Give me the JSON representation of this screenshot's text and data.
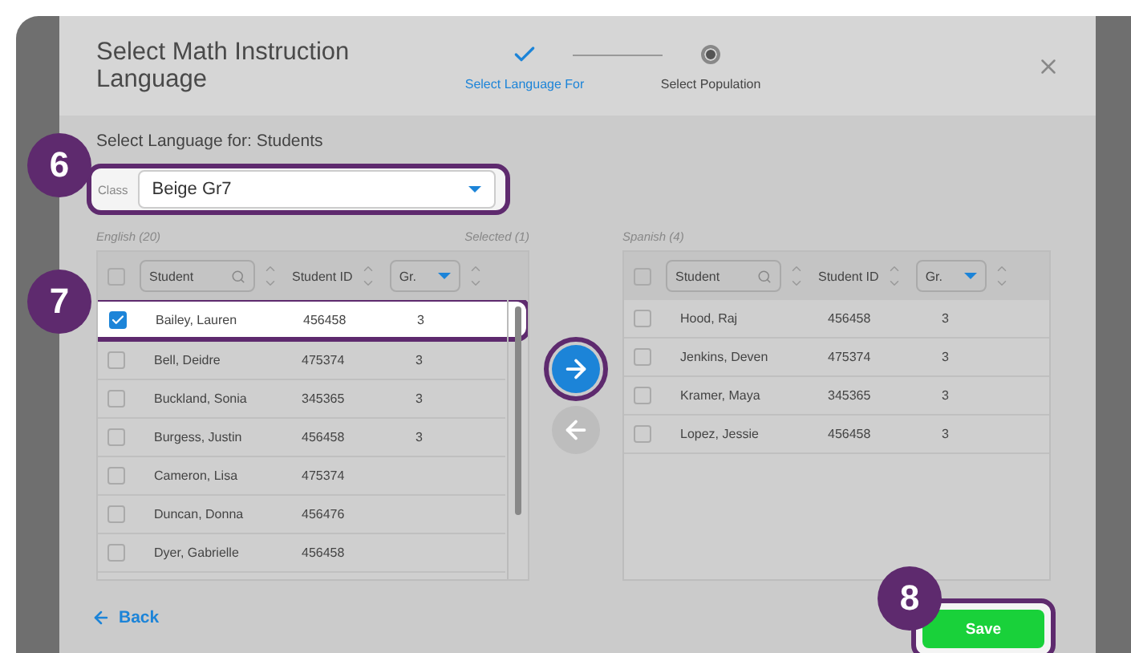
{
  "modal": {
    "title": "Select Math Instruction Language",
    "steps": [
      {
        "label": "Select Language For",
        "done": true
      },
      {
        "label": "Select Population",
        "done": false
      }
    ]
  },
  "prompt": "Select Language for: Students",
  "class_field": {
    "label": "Class",
    "value": "Beige Gr7"
  },
  "left_list": {
    "all_checked": false,
    "title": "English (20)",
    "selected_count": "Selected (1)",
    "columns": [
      "Student",
      "Student ID",
      "Gr."
    ],
    "rows": [
      {
        "name": "Bailey, Lauren",
        "id": "456458",
        "grade": "3",
        "checked": true
      },
      {
        "name": "Bell, Deidre",
        "id": "475374",
        "grade": "3",
        "checked": false
      },
      {
        "name": "Buckland, Sonia",
        "id": "345365",
        "grade": "3",
        "checked": false
      },
      {
        "name": "Burgess, Justin",
        "id": "456458",
        "grade": "3",
        "checked": false
      },
      {
        "name": "Cameron, Lisa",
        "id": "475374",
        "checked": false
      },
      {
        "name": "Duncan, Donna",
        "id": "456476",
        "checked": false
      },
      {
        "name": "Dyer, Gabrielle",
        "id": "456458",
        "checked": false
      }
    ]
  },
  "right_list": {
    "all_checked": false,
    "title": "Spanish (4)",
    "columns": [
      "Student",
      "Student ID",
      "Gr."
    ],
    "rows": [
      {
        "name": "Hood, Raj",
        "id": "456458",
        "grade": "3",
        "checked": false
      },
      {
        "name": "Jenkins, Deven",
        "id": "475374",
        "grade": "3",
        "checked": false
      },
      {
        "name": "Kramer, Maya",
        "id": "345365",
        "grade": "3",
        "checked": false
      },
      {
        "name": "Lopez, Jessie",
        "id": "456458",
        "grade": "3",
        "checked": false
      }
    ]
  },
  "move_right": {
    "disabled": false
  },
  "move_left": {
    "disabled": true
  },
  "back": "Back",
  "save": "Save",
  "callouts": [
    "6",
    "7",
    "8"
  ]
}
